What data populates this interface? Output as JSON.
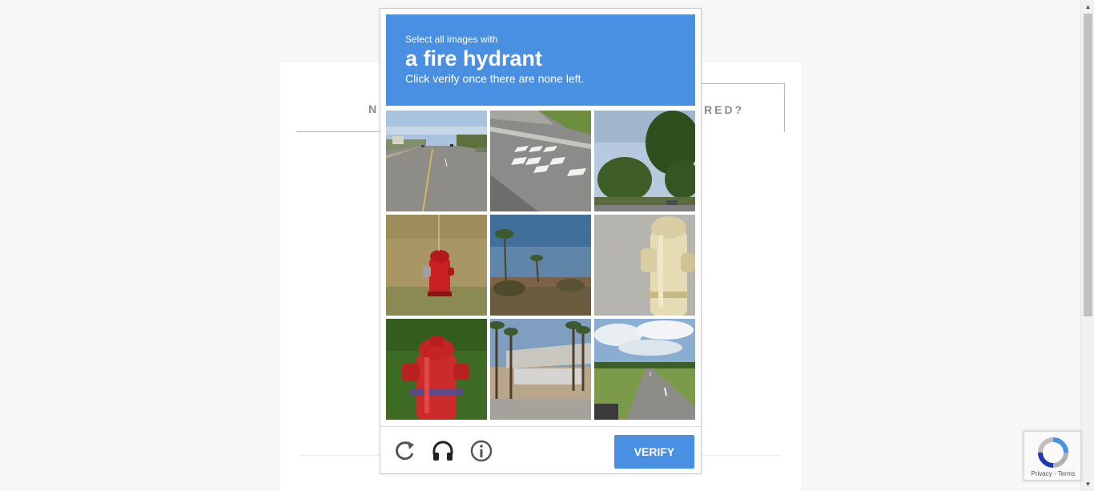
{
  "background_page": {
    "left_tab_label": "N",
    "right_tab_label": "RED?"
  },
  "captcha": {
    "header": {
      "instruction_small": "Select all images with",
      "target_object": "a fire hydrant",
      "instruction_sub": "Click verify once there are none left."
    },
    "tiles": [
      {
        "index": 1,
        "scene": "road with vehicles"
      },
      {
        "index": 2,
        "scene": "crosswalk"
      },
      {
        "index": 3,
        "scene": "trees and sky"
      },
      {
        "index": 4,
        "scene": "red fire hydrant in grass"
      },
      {
        "index": 5,
        "scene": "palm trees and dry brush"
      },
      {
        "index": 6,
        "scene": "cream fire hydrant on pavement"
      },
      {
        "index": 7,
        "scene": "red fire hydrant close-up"
      },
      {
        "index": 8,
        "scene": "overpass with palm trees"
      },
      {
        "index": 9,
        "scene": "highway under cloudy sky"
      }
    ],
    "footer": {
      "reload_icon": "reload-icon",
      "audio_icon": "headphones-icon",
      "info_icon": "info-icon",
      "verify_label": "VERIFY"
    },
    "colors": {
      "accent": "#4a90e2"
    }
  },
  "recaptcha_badge": {
    "privacy_label": "Privacy",
    "separator": " - ",
    "terms_label": "Terms"
  }
}
